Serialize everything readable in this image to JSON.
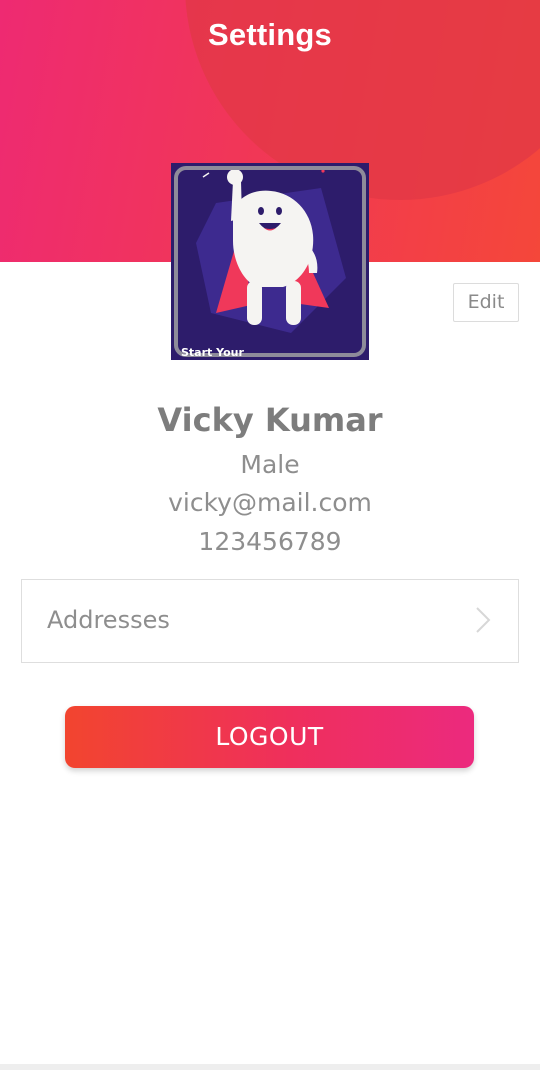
{
  "header": {
    "title": "Settings",
    "gradient_start": "#ee2a72",
    "gradient_end": "#f4473a"
  },
  "profile": {
    "avatar_caption": "Start Your",
    "edit_label": "Edit",
    "name": "Vicky Kumar",
    "gender": "Male",
    "email": "vicky@mail.com",
    "phone": "123456789"
  },
  "menu": {
    "addresses_label": "Addresses",
    "chevron_icon": "chevron-right-icon"
  },
  "actions": {
    "logout_label": "LOGOUT",
    "logout_gradient_start": "#f2452f",
    "logout_gradient_end": "#ec2a7e"
  }
}
